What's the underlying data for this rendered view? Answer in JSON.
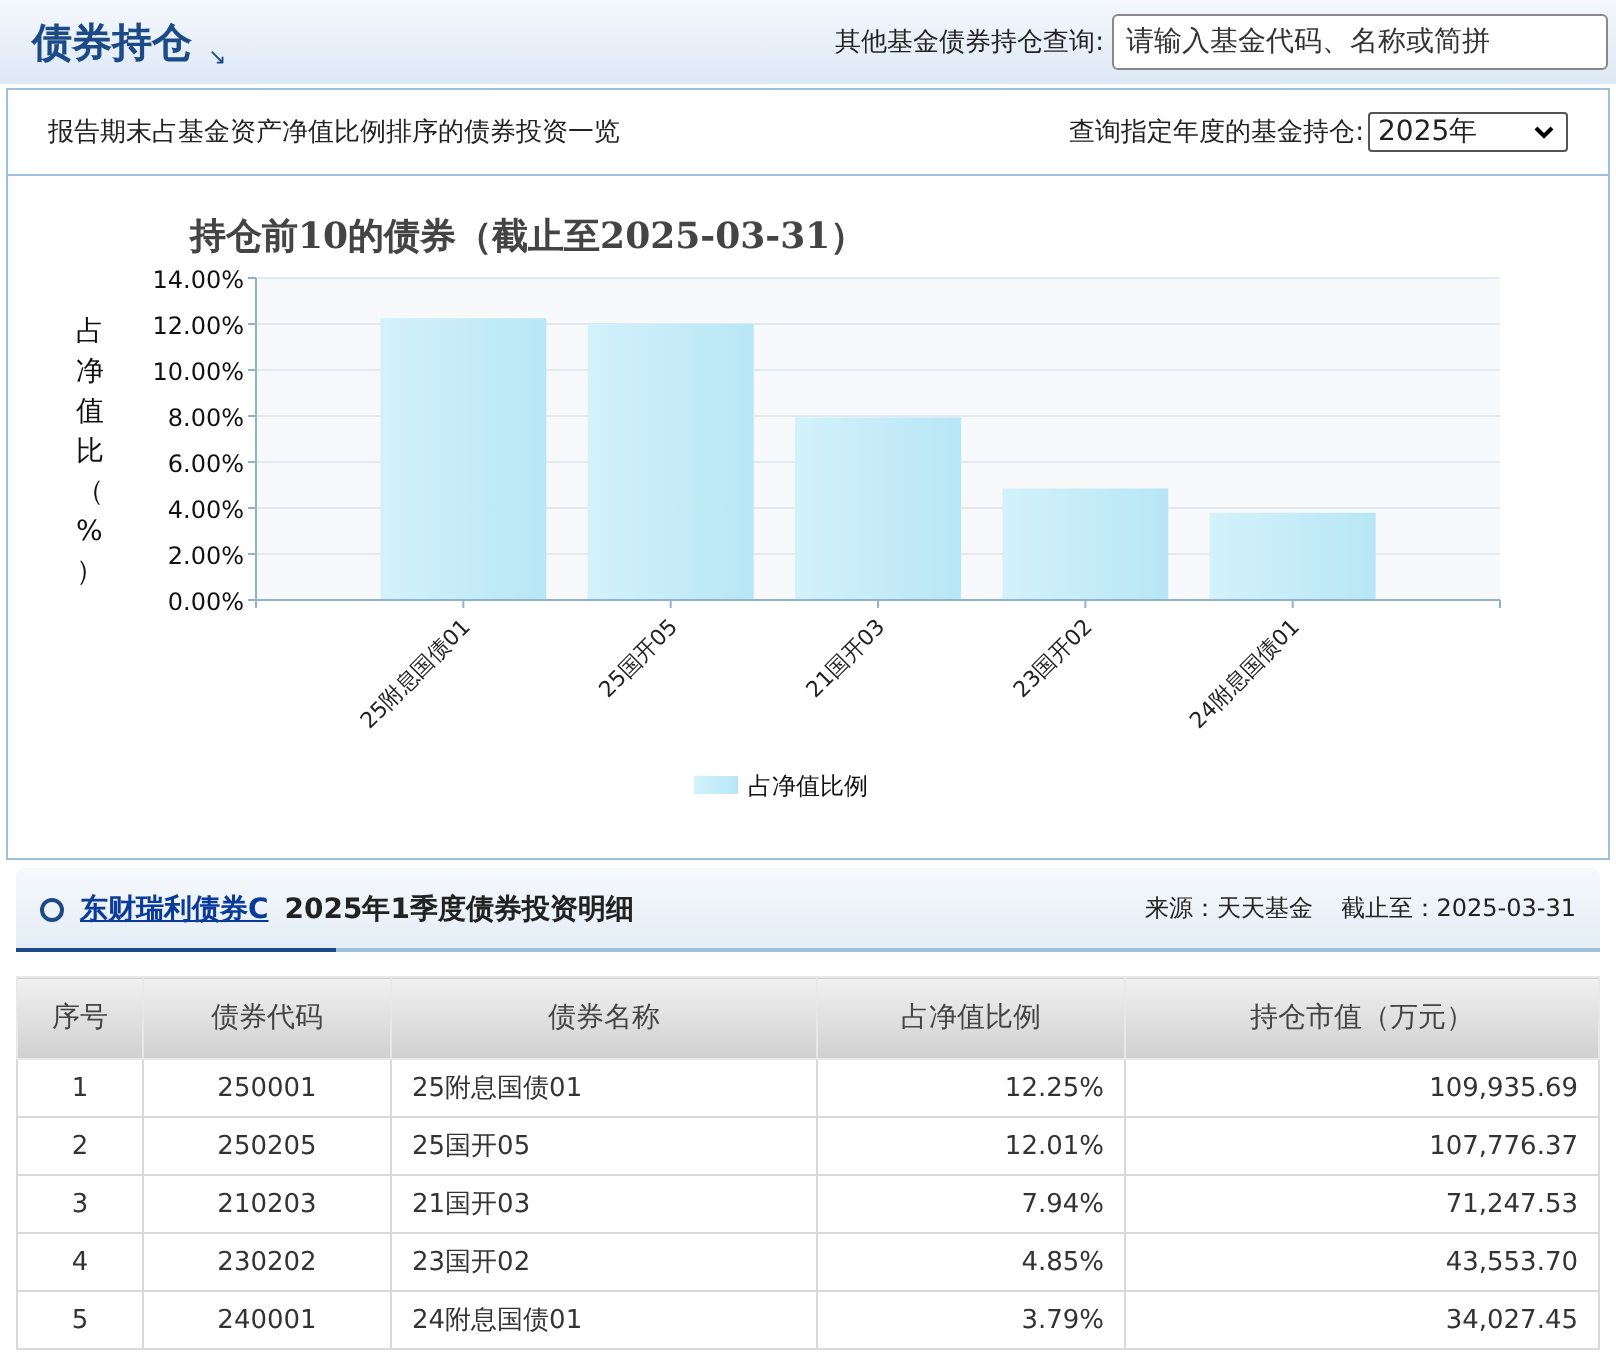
{
  "header": {
    "title": "债券持仓",
    "corner_icon": "↘",
    "search_label": "其他基金债券持仓查询:",
    "search_placeholder": "请输入基金代码、名称或简拼"
  },
  "subheader": {
    "description": "报告期末占基金资产净值比例排序的债券投资一览",
    "year_label": "查询指定年度的基金持仓:",
    "year_value": "2025年"
  },
  "chart": {
    "chart_data": {
      "type": "bar",
      "title": "持仓前10的债券（截止至2025-03-31）",
      "ylabel": "占净值比（%）",
      "categories": [
        "25附息国债01",
        "25国开05",
        "21国开03",
        "23国开02",
        "24附息国债01"
      ],
      "series": [
        {
          "name": "占净值比例",
          "color": "#b8e6f5",
          "values": [
            12.25,
            12.01,
            7.94,
            4.85,
            3.79
          ]
        }
      ],
      "ylim": [
        0,
        14
      ],
      "grid": true,
      "yticks": [
        {
          "value": 0,
          "label": "0.00%"
        },
        {
          "value": 2,
          "label": "2.00%"
        },
        {
          "value": 4,
          "label": "4.00%"
        },
        {
          "value": 6,
          "label": "6.00%"
        },
        {
          "value": 8,
          "label": "8.00%"
        },
        {
          "value": 10,
          "label": "10.00%"
        },
        {
          "value": 12,
          "label": "12.00%"
        },
        {
          "value": 14,
          "label": "14.00%"
        }
      ]
    }
  },
  "detail": {
    "fund_link": "东财瑞利债券C",
    "title": "2025年1季度债券投资明细",
    "source": "来源：天天基金",
    "as_of": "截止至：2025-03-31"
  },
  "table": {
    "columns": [
      "序号",
      "债券代码",
      "债券名称",
      "占净值比例",
      "持仓市值（万元）"
    ],
    "rows": [
      [
        "1",
        "250001",
        "25附息国债01",
        "12.25%",
        "109,935.69"
      ],
      [
        "2",
        "250205",
        "25国开05",
        "12.01%",
        "107,776.37"
      ],
      [
        "3",
        "210203",
        "21国开03",
        "7.94%",
        "71,247.53"
      ],
      [
        "4",
        "230202",
        "23国开02",
        "4.85%",
        "43,553.70"
      ],
      [
        "5",
        "240001",
        "24附息国债01",
        "3.79%",
        "34,027.45"
      ]
    ]
  }
}
